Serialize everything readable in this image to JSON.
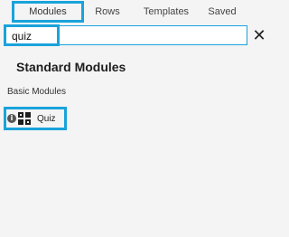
{
  "tabs": {
    "modules": "Modules",
    "rows": "Rows",
    "templates": "Templates",
    "saved": "Saved"
  },
  "search": {
    "value": "quiz",
    "close_icon": "close-icon"
  },
  "section": {
    "title": "Standard Modules",
    "group_label": "Basic Modules"
  },
  "modules": [
    {
      "label": "Quiz",
      "icon": "quiz-icon",
      "info_icon": "info-icon",
      "info_glyph": "i"
    }
  ],
  "colors": {
    "highlight": "#1aa3db",
    "background": "#f4f4f5",
    "text": "#222222"
  }
}
